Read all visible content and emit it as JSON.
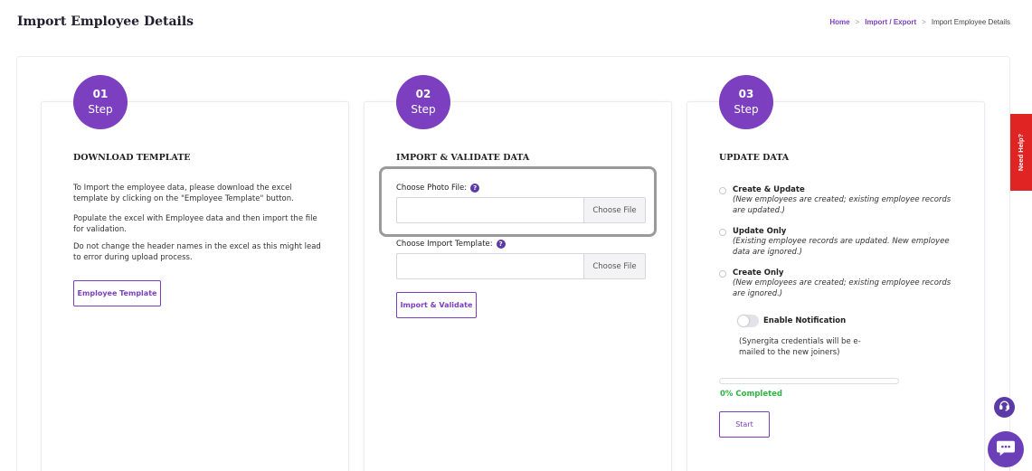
{
  "page": {
    "title": "Import Employee Details"
  },
  "breadcrumb": {
    "home": "Home",
    "sep1": ">",
    "section": "Import / Export",
    "sep2": ">",
    "current": "Import Employee Details"
  },
  "step1": {
    "number": "01",
    "step_label": "Step",
    "title": "DOWNLOAD TEMPLATE",
    "para1": "To Import the employee data, please download the excel template by clicking on the \"Employee Template\" button.",
    "para2": "Populate the excel with Employee data and then import the file for validation.",
    "para3": "Do not change the header names in the excel as this might lead to error during upload process.",
    "button": "Employee Template"
  },
  "step2": {
    "number": "02",
    "step_label": "Step",
    "title": "IMPORT & VALIDATE DATA",
    "photo_label": "Choose Photo File:",
    "photo_button": "Choose File",
    "template_label": "Choose Import Template:",
    "template_button": "Choose File",
    "help_glyph": "?",
    "button": "Import & Validate"
  },
  "step3": {
    "number": "03",
    "step_label": "Step",
    "title": "UPDATE DATA",
    "options": [
      {
        "label": "Create & Update",
        "desc": "(New employees are created; existing employee records are updated.)"
      },
      {
        "label": "Update Only",
        "desc": "(Existing employee records are updated. New employee data are ignored.)"
      },
      {
        "label": "Create Only",
        "desc": "(New employees are created; existing employee records are ignored.)"
      }
    ],
    "notification_label": "Enable Notification",
    "notification_note": "(Synergita credentials will be e-mailed to the new joiners)",
    "progress_value": 0,
    "progress_text": "0% Completed",
    "start_button": "Start"
  },
  "need_help": "Need Help?",
  "colors": {
    "accent": "#7b3fbf",
    "success": "#2fb344",
    "help_tab": "#e02424"
  }
}
